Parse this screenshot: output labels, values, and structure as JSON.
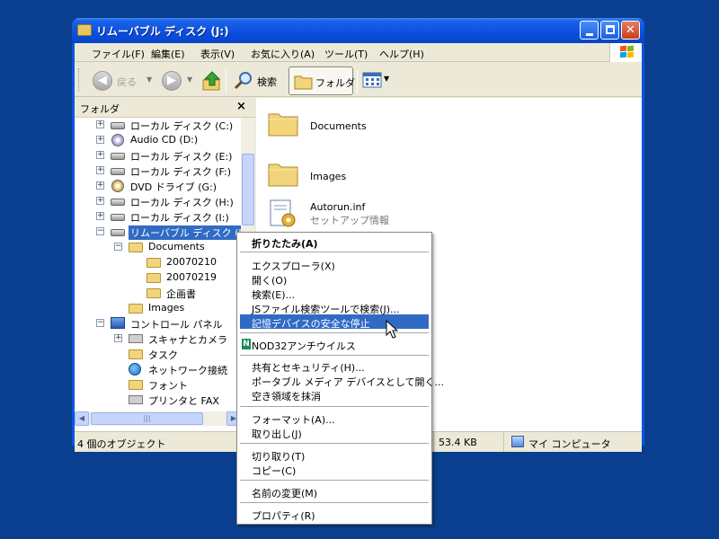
{
  "window": {
    "title": "リムーバブル ディスク (J:)"
  },
  "menubar": [
    "ファイル(F)",
    "編集(E)",
    "表示(V)",
    "お気に入り(A)",
    "ツール(T)",
    "ヘルプ(H)"
  ],
  "toolbar": {
    "back": "戻る",
    "search": "検索",
    "folders": "フォルダ"
  },
  "tree": {
    "header": "フォルダ",
    "close": "×",
    "items": [
      {
        "label": "ローカル ディスク (C:)",
        "icon": "drive-icon"
      },
      {
        "label": "Audio CD (D:)",
        "icon": "cd-icon"
      },
      {
        "label": "ローカル ディスク (E:)",
        "icon": "drive-icon"
      },
      {
        "label": "ローカル ディスク (F:)",
        "icon": "drive-icon"
      },
      {
        "label": "DVD ドライブ (G:)",
        "icon": "dvd-icon"
      },
      {
        "label": "ローカル ディスク (H:)",
        "icon": "drive-icon"
      },
      {
        "label": "ローカル ディスク (I:)",
        "icon": "drive-icon"
      },
      {
        "label": "リムーバブル ディスク (J:)",
        "icon": "removable-drive-icon"
      },
      {
        "label": "Documents",
        "icon": "folder-icon"
      },
      {
        "label": "20070210",
        "icon": "folder-icon"
      },
      {
        "label": "20070219",
        "icon": "folder-icon"
      },
      {
        "label": "企画書",
        "icon": "folder-icon"
      },
      {
        "label": "Images",
        "icon": "folder-icon"
      },
      {
        "label": "コントロール パネル",
        "icon": "control-panel-icon"
      },
      {
        "label": "スキャナとカメラ",
        "icon": "scanner-icon"
      },
      {
        "label": "タスク",
        "icon": "folder-icon"
      },
      {
        "label": "ネットワーク接続",
        "icon": "network-icon"
      },
      {
        "label": "フォント",
        "icon": "folder-icon"
      },
      {
        "label": "プリンタと FAX",
        "icon": "printer-icon"
      }
    ]
  },
  "files": [
    {
      "name": "Documents",
      "icon": "folder-icon"
    },
    {
      "name": "Images",
      "icon": "folder-icon"
    },
    {
      "name": "Autorun.inf",
      "desc": "セットアップ情報",
      "icon": "setup-info-icon"
    }
  ],
  "status": {
    "count": "4 個のオブジェクト",
    "size": "53.4 KB",
    "location": "マイ コンピュータ"
  },
  "context_menu": [
    "折りたたみ(A)",
    "エクスプローラ(X)",
    "開く(O)",
    "検索(E)...",
    "JSファイル検索ツールで検索(J)...",
    "記憶デバイスの安全な停止",
    "NOD32アンチウイルス",
    "共有とセキュリティ(H)...",
    "ポータブル メディア デバイスとして開く...",
    "空き領域を抹消",
    "フォーマット(A)...",
    "取り出し(J)",
    "切り取り(T)",
    "コピー(C)",
    "名前の変更(M)",
    "プロパティ(R)"
  ],
  "colors": {
    "desktop": "#0a3f8f",
    "titlebar": "#0a55e0",
    "selection": "#316ac5"
  }
}
